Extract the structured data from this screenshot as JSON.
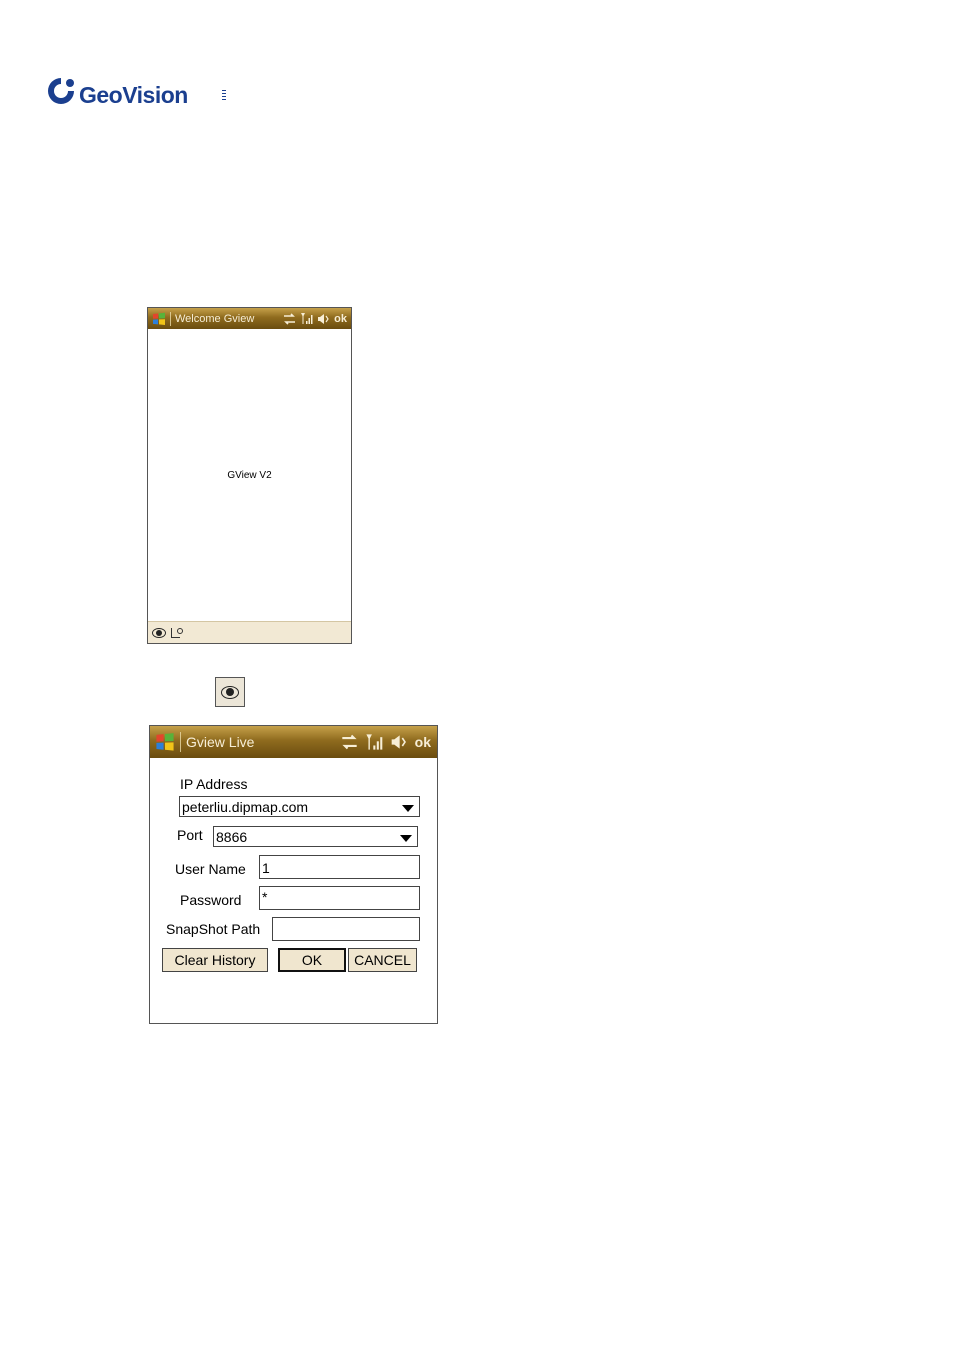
{
  "brand": {
    "name": "GeoVision",
    "color": "#1b3f8f"
  },
  "screen1": {
    "title": "Welcome Gview",
    "tray_ok": "ok",
    "splash_text": "GView V2",
    "menubar_icons": [
      "eye-icon",
      "keyboard-icon"
    ]
  },
  "eye_button": {
    "icon": "eye-icon"
  },
  "screen2": {
    "title": "Gview Live",
    "tray_ok": "ok",
    "fields": {
      "ip_label": "IP Address",
      "ip_value": "peterliu.dipmap.com",
      "port_label": "Port",
      "port_value": "8866",
      "user_label": "User Name",
      "user_value": "1",
      "password_label": "Password",
      "password_value": "*",
      "snapshot_label": "SnapShot Path",
      "snapshot_value": ""
    },
    "buttons": {
      "clear_history": "Clear History",
      "ok": "OK",
      "cancel": "CANCEL"
    }
  },
  "colors": {
    "titlebar_top": "#c6a14a",
    "titlebar_bottom": "#6a4c0f",
    "menubar": "#f2e9d4",
    "button_face": "#f0e6cf"
  }
}
